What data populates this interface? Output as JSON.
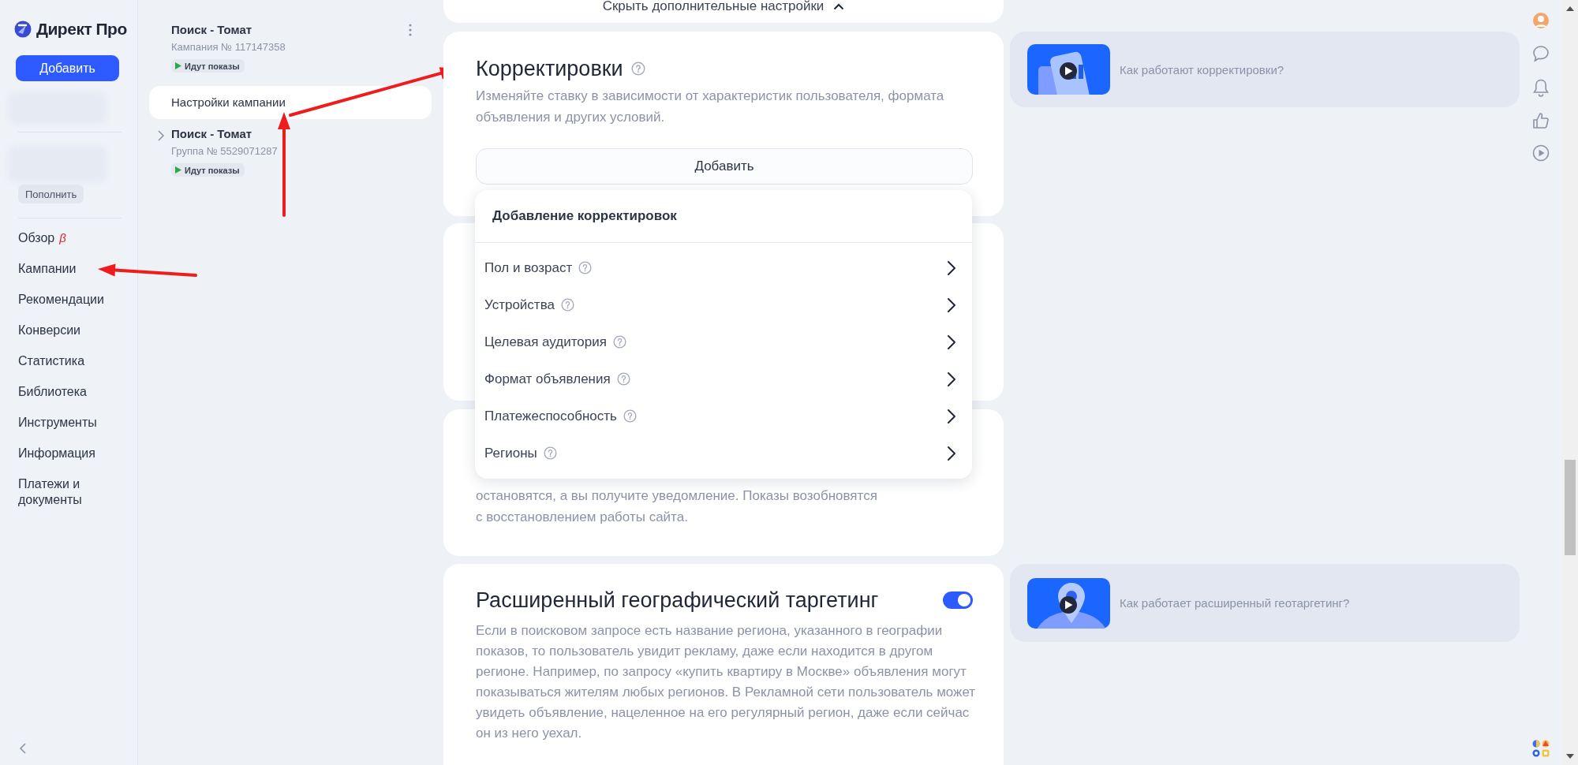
{
  "sidebar": {
    "logo": "Директ Про",
    "add_button": "Добавить",
    "top_up_button": "Пополнить",
    "nav": [
      {
        "label": "Обзор",
        "badge": "β"
      },
      {
        "label": "Кампании"
      },
      {
        "label": "Рекомендации"
      },
      {
        "label": "Конверсии"
      },
      {
        "label": "Статистика"
      },
      {
        "label": "Библиотека"
      },
      {
        "label": "Инструменты"
      },
      {
        "label": "Информация"
      },
      {
        "label": "Платежи и документы"
      }
    ]
  },
  "campaign_tree": {
    "campaign": {
      "title": "Поиск - Томат",
      "subtitle": "Кампания № 117147358",
      "status": "Идут показы"
    },
    "items": [
      {
        "label": "Настройки кампании",
        "selected": true
      }
    ],
    "group": {
      "title": "Поиск - Томат",
      "subtitle": "Группа № 5529071287",
      "status": "Идут показы",
      "expanded": false
    }
  },
  "settings": {
    "collapse_link": "Скрыть дополнительные настройки",
    "adjustments": {
      "title": "Корректировки",
      "description": "Изменяйте ставку в зависимости от характеристик пользователя, формата объявления и других условий.",
      "add_button": "Добавить",
      "menu": {
        "title": "Добавление корректировок",
        "items": [
          "Пол и возраст",
          "Устройства",
          "Целевая аудитория",
          "Формат объявления",
          "Платежеспособность",
          "Регионы"
        ]
      }
    },
    "site_monitoring": {
      "description": "остановятся, а вы получите уведомление. Показы возобновятся с восстановлением работы сайта."
    },
    "geo": {
      "title": "Расширенный географический таргетинг",
      "on": true,
      "description": "Если в поисковом запросе есть название региона, указанного в географии показов, то пользователь увидит рекламу, даже если находится в другом регионе. Например, по запросу «купить квартиру в Москве» объявления могут показываться жителям любых регионов. В Рекламной сети пользователь может увидеть объявление, нацеленное на его регулярный регион, даже если сейчас он из него уехал."
    }
  },
  "help_videos": [
    {
      "title": "Как работают корректировки?"
    },
    {
      "title": "Как работает расширенный геотаргетинг?"
    }
  ]
}
